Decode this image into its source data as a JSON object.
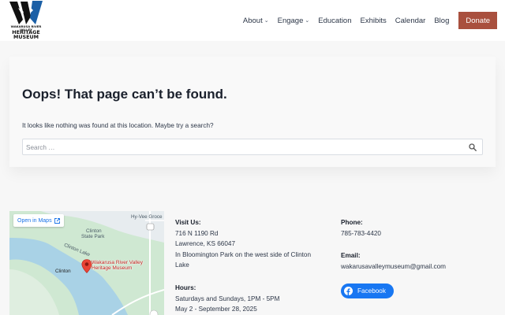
{
  "header": {
    "logo": {
      "line1": "WAKARUSA RIVER VALLEY",
      "line2": "HERITAGE",
      "line3": "MUSEUM"
    },
    "nav": [
      {
        "label": "About",
        "has_dropdown": true
      },
      {
        "label": "Engage",
        "has_dropdown": true
      },
      {
        "label": "Education",
        "has_dropdown": false
      },
      {
        "label": "Exhibits",
        "has_dropdown": false
      },
      {
        "label": "Calendar",
        "has_dropdown": false
      },
      {
        "label": "Blog",
        "has_dropdown": false
      }
    ],
    "donate_label": "Donate",
    "donate_color": "#a9503e"
  },
  "notfound": {
    "title": "Oops! That page can’t be found.",
    "message": "It looks like nothing was found at this location. Maybe try a search?",
    "search_placeholder": "Search …"
  },
  "map": {
    "open_in_maps": "Open in Maps",
    "labels": {
      "hy_vee": "Hy-Vee Groce",
      "park_line1": "Clinton",
      "park_line2": "State Park",
      "lake": "Clinton Lake",
      "town": "Clinton",
      "pin_line1": "Wakarusa River Valley",
      "pin_line2": "Heritage Museum"
    }
  },
  "footer": {
    "visit": {
      "heading": "Visit Us:",
      "line1": "716 N 1190 Rd",
      "line2": "Lawrence, KS 66047",
      "line3": "In Bloomington Park on the west side of Clinton Lake"
    },
    "hours": {
      "heading": "Hours:",
      "line1": "Saturdays and Sundays, 1PM - 5PM",
      "line2": "May 2 - September 28, 2025"
    },
    "phone": {
      "heading": "Phone:",
      "value": "785-783-4420"
    },
    "email": {
      "heading": "Email:",
      "value": "wakarusavalleymuseum@gmail.com"
    },
    "facebook_label": "Facebook",
    "facebook_color": "#1877f2"
  }
}
